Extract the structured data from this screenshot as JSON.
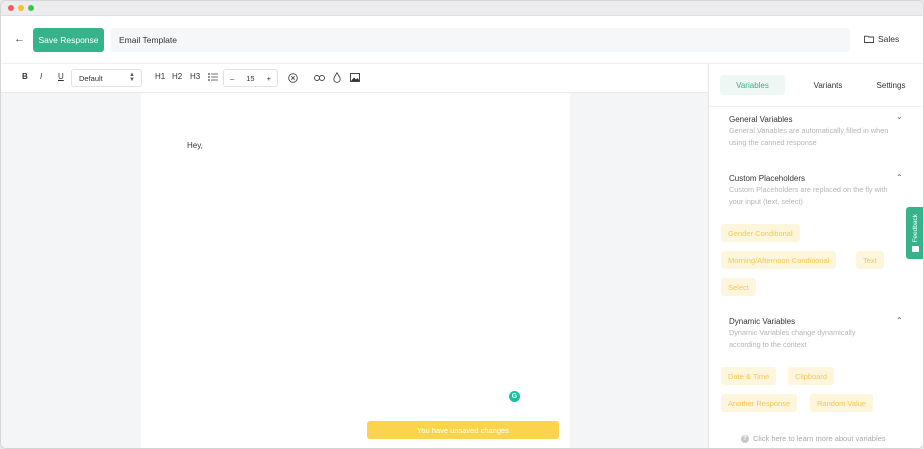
{
  "window": {
    "dots": [
      {
        "name": "close-dot",
        "color": "#f25f58"
      },
      {
        "name": "minimize-dot",
        "color": "#f9be2e"
      },
      {
        "name": "zoom-dot",
        "color": "#36c84a"
      }
    ]
  },
  "header": {
    "back_icon": "arrow-left-icon",
    "save_label": "Save Response",
    "template_name": "Email Template",
    "folder_icon": "folder-icon",
    "folder_label": "Sales"
  },
  "toolbar": {
    "bold": "B",
    "italic": "I",
    "underline": "U",
    "font_select": "Default",
    "h1": "H1",
    "h2": "H2",
    "h3": "H3",
    "font_size_minus": "–",
    "font_size": "15",
    "font_size_plus": "+"
  },
  "editor": {
    "body_text": "Hey,",
    "unsaved_notice": "You have unsaved changes",
    "grammarly_badge": "G"
  },
  "sidebar": {
    "tabs": [
      {
        "label": "Variables",
        "active": true
      },
      {
        "label": "Variants",
        "active": false
      },
      {
        "label": "Settings",
        "active": false
      }
    ],
    "general": {
      "title": "General Variables",
      "description": "General Variables are automatically filled in when using the canned response"
    },
    "custom": {
      "title": "Custom Placeholders",
      "description": "Custom Placeholders are replaced on the fly with your input (text, select)",
      "chips": [
        "Gender Conditional",
        "Morning/Afternoon Conditional",
        "Text",
        "Select"
      ]
    },
    "dynamic": {
      "title": "Dynamic Variables",
      "description": "Dynamic Variables change dynamically according to the context",
      "chips": [
        "Date & Time",
        "Clipboard",
        "Another Response",
        "Random Value"
      ]
    },
    "help_text": "Click here to learn more about variables",
    "help_icon": "?"
  },
  "feedback": {
    "label": "Feedback"
  },
  "colors": {
    "accent": "#36b38a",
    "warning": "#fcd34d",
    "chip_bg": "#fef6dc",
    "chip_text": "#f6c64b"
  }
}
